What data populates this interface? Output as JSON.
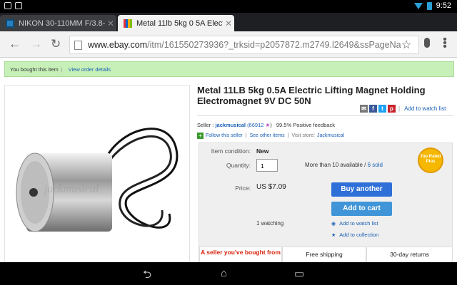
{
  "status_bar": {
    "time": "9:52"
  },
  "tabs": [
    {
      "title": "NIKON 30-110MM F/3.8-5.6",
      "active": false
    },
    {
      "title": "Metal 11lb 5kg 0 5A Electric",
      "active": true
    }
  ],
  "omnibox": {
    "url_domain": "www.ebay.com",
    "url_rest": "/itm/161550273936?_trksid=p2057872.m2749.l2649&ssPageNa"
  },
  "banner": {
    "text": "You bought this item",
    "link": "View order details"
  },
  "product": {
    "title": "Metal 11LB 5kg 0.5A Electric Lifting Magnet Holding Electromagnet 9V DC 50N",
    "watch_link": "Add to watch list",
    "watermark": "jackmusical"
  },
  "seller": {
    "label": "Seller :",
    "name": "jackmusical",
    "score": "(66912",
    "feedback": "99.5% Positive feedback",
    "follow": "Follow this seller",
    "see_other": "See other items",
    "visit_store_label": "Visit store:",
    "store": "Jackmusical"
  },
  "buybox": {
    "condition_label": "Item condition:",
    "condition_value": "New",
    "quantity_label": "Quantity:",
    "quantity_value": "1",
    "available": "More than 10 available /",
    "sold": "6 sold",
    "price_label": "Price:",
    "price_value": "US $7.09",
    "buy_button": "Buy another",
    "cart_button": "Add to cart",
    "watching": "1 watching",
    "add_watch": "Add to watch list",
    "add_collection": "Add to collection",
    "badge": "Top Rated Plus"
  },
  "features": [
    "A seller you've bought from",
    "Free shipping",
    "30-day returns"
  ],
  "colors": {
    "accent": "#2f6fd8",
    "banner": "#c7f0b9",
    "link": "#1a5fb4"
  }
}
